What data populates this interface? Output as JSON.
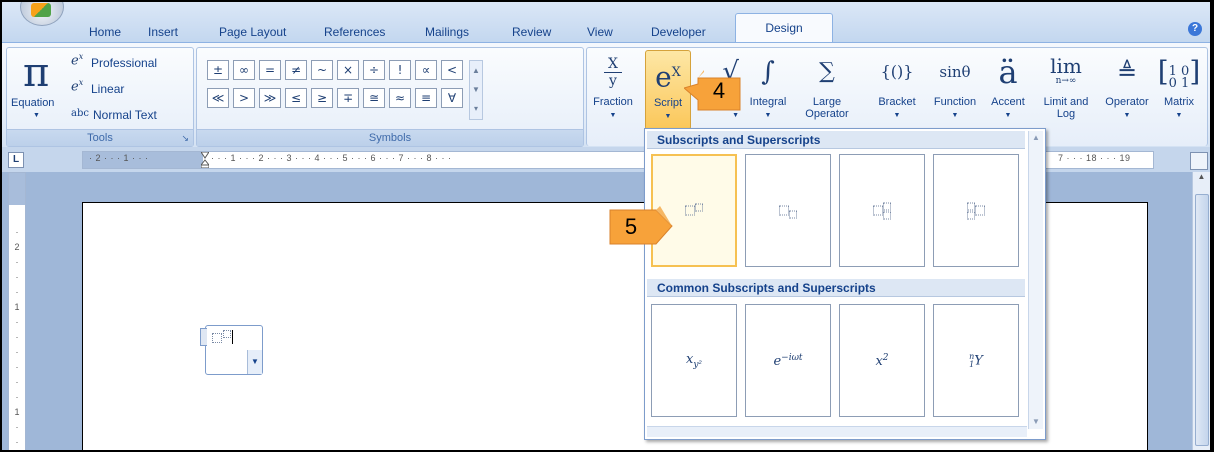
{
  "tabs": [
    "Home",
    "Insert",
    "Page Layout",
    "References",
    "Mailings",
    "Review",
    "View",
    "Developer",
    "Design"
  ],
  "active_tab": "Design",
  "tools_group": {
    "equation_label": "Equation",
    "professional": "Professional",
    "linear": "Linear",
    "normal_text": "Normal Text",
    "label": "Tools"
  },
  "symbols_group": {
    "row1": [
      "±",
      "∞",
      "=",
      "≠",
      "~",
      "×",
      "÷",
      "!",
      "∝",
      "<"
    ],
    "row2": [
      "≪",
      ">",
      "≫",
      "≤",
      "≥",
      "∓",
      "≅",
      "≈",
      "≡",
      "∀"
    ],
    "label": "Symbols"
  },
  "structures": [
    {
      "label": "Fraction"
    },
    {
      "label": "Script"
    },
    {
      "label": "Radical"
    },
    {
      "label": "Integral"
    },
    {
      "label": "Large",
      "label2": "Operator"
    },
    {
      "label": "Bracket"
    },
    {
      "label": "Function"
    },
    {
      "label": "Accent"
    },
    {
      "label": "Limit and",
      "label2": "Log"
    },
    {
      "label": "Operator"
    },
    {
      "label": "Matrix"
    }
  ],
  "glyphs": {
    "fraction_top": "X",
    "fraction_bottom": "y",
    "script": "eX",
    "integral": "∫",
    "large_op": "∑",
    "bracket": "{()}",
    "function": "sinθ",
    "accent": "ä",
    "limit": "lim",
    "limit_sub": "n→∞",
    "operator": "≜",
    "matrix": "[10 01]"
  },
  "ruler": {
    "left_text": "· 2 · · · 1 · · ·",
    "mid_text": "· · · 1 · · · 2 · · · 3 · · · 4 · · · 5 · · · 6 · · · 7 · · · 8 · · ·",
    "right_text": "7 · · · 18 · · · 19"
  },
  "gallery": {
    "section1": "Subscripts and Superscripts",
    "section2": "Common Subscripts and Superscripts",
    "common": [
      {
        "base": "x",
        "script": "y²"
      },
      {
        "base": "e",
        "script": "−iωt"
      },
      {
        "base": "x",
        "script": "2"
      },
      {
        "base": "Y",
        "script": "n",
        "pre": "1"
      }
    ]
  },
  "callouts": {
    "step4": "4",
    "step5": "5"
  },
  "colors": {
    "callout_orange": "#f7a23a",
    "highlight": "#fbc75a",
    "ribbon_text": "#15428b"
  }
}
